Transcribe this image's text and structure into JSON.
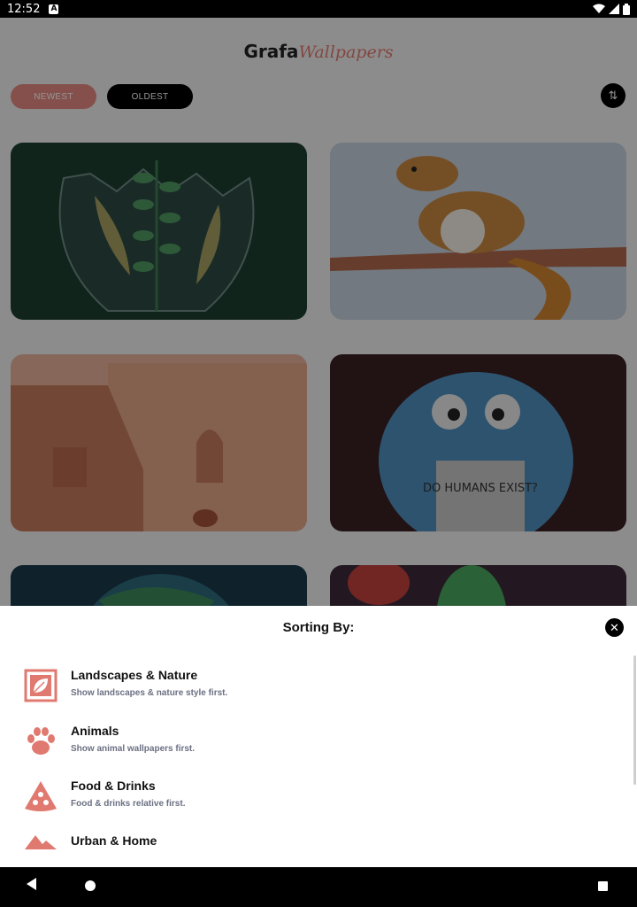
{
  "status_bar": {
    "time": "12:52",
    "notification_icon": "A"
  },
  "header": {
    "logo_primary": "Grafa",
    "logo_secondary": "Wallpapers"
  },
  "filters": {
    "newest_label": "NEWEST",
    "oldest_label": "OLDEST",
    "sort_icon": "⇅"
  },
  "gallery": {
    "items": [
      {
        "subject": "plant-bulb-illustration",
        "bg": "#1c3f31"
      },
      {
        "subject": "squirrel-on-branch-illustration",
        "bg": "#c7d0dd"
      },
      {
        "subject": "terracotta-buildings-illustration",
        "bg": "#e9b19b"
      },
      {
        "subject": "blue-monster-reading-illustration",
        "bg": "#3a1f24"
      },
      {
        "subject": "globe-illustration",
        "bg": "#1a3a4a"
      },
      {
        "subject": "cactus-illustration",
        "bg": "#3d2a3a"
      }
    ],
    "monster_book_text": "DO HUMANS EXIST?"
  },
  "sheet": {
    "title": "Sorting By:",
    "close_icon": "✕",
    "options": [
      {
        "name": "Landscapes & Nature",
        "desc": "Show landscapes & nature style first.",
        "icon": "leaf-frame-icon"
      },
      {
        "name": "Animals",
        "desc": "Show animal wallpapers first.",
        "icon": "paw-icon"
      },
      {
        "name": "Food & Drinks",
        "desc": "Food & drinks relative first.",
        "icon": "pizza-slice-icon"
      },
      {
        "name": "Urban & Home",
        "desc": "",
        "icon": "mountain-house-icon"
      }
    ],
    "accent_color": "#e07a70"
  }
}
